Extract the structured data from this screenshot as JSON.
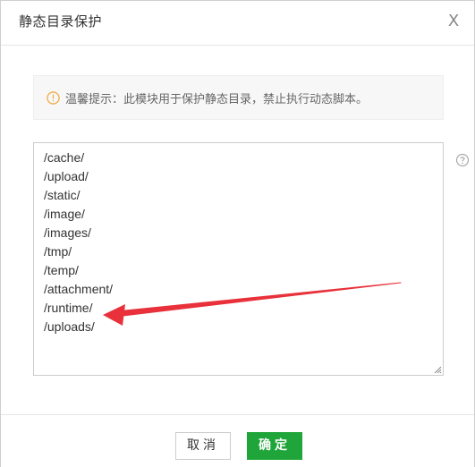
{
  "dialog": {
    "title": "静态目录保护",
    "close_glyph": "X"
  },
  "notice": {
    "icon": "warning-circle-icon",
    "text": "温馨提示：此模块用于保护静态目录，禁止执行动态脚本。"
  },
  "protected_dirs": [
    "/cache/",
    "/upload/",
    "/static/",
    "/image/",
    "/images/",
    "/tmp/",
    "/temp/",
    "/attachment/",
    "/runtime/",
    "/uploads/"
  ],
  "help_icon": "question-circle-icon",
  "footer": {
    "cancel_label": "取消",
    "ok_label": "确定"
  },
  "colors": {
    "primary_green": "#20a53a",
    "notice_icon_orange": "#f0ad4e",
    "annotation_arrow_red": "#e8313a"
  }
}
